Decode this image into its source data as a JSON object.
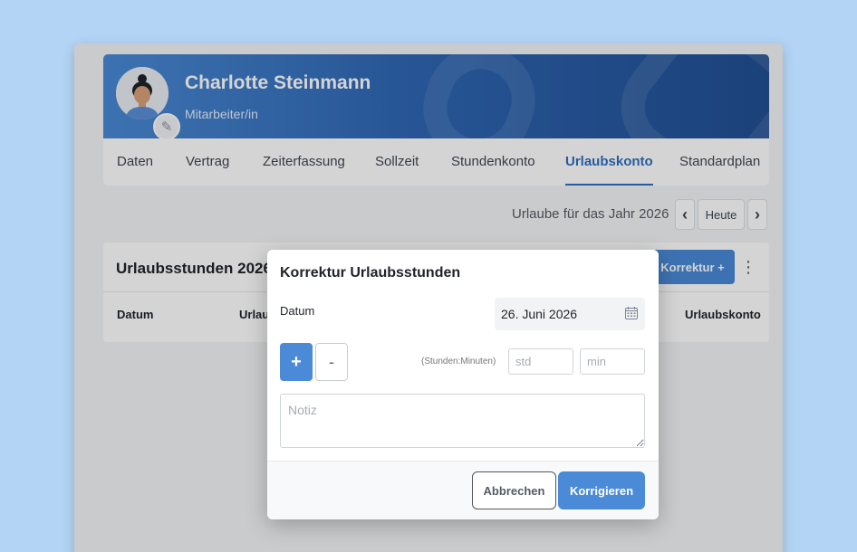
{
  "employee": {
    "name": "Charlotte Steinmann",
    "role": "Mitarbeiter/in"
  },
  "tabs": [
    {
      "label": "Daten"
    },
    {
      "label": "Vertrag"
    },
    {
      "label": "Zeiterfassung"
    },
    {
      "label": "Sollzeit"
    },
    {
      "label": "Stundenkonto"
    },
    {
      "label": "Urlaubskonto",
      "active": true
    },
    {
      "label": "Standardplan"
    }
  ],
  "year_nav": {
    "label": "Urlaube für das Jahr 2026",
    "today_label": "Heute",
    "prev_icon": "‹",
    "next_icon": "›"
  },
  "card": {
    "title": "Urlaubsstunden 2026",
    "korrektur_label": "Korrektur +",
    "menu_icon": "⋮",
    "columns": [
      "Datum",
      "Urlau",
      "Urlaubskonto"
    ]
  },
  "modal": {
    "title": "Korrektur Urlaubsstunden",
    "datum_label": "Datum",
    "datum_value": "26. Juni 2026",
    "plus_label": "+",
    "minus_label": "-",
    "hm_label": "(Stunden:Minuten)",
    "hours_placeholder": "std",
    "minutes_placeholder": "min",
    "note_placeholder": "Notiz",
    "cancel_label": "Abbrechen",
    "confirm_label": "Korrigieren"
  },
  "colors": {
    "accent": "#4a8ad6",
    "header_dark": "#214f93",
    "active_tab": "#2f6fc2",
    "background": "#b3d4f5"
  }
}
